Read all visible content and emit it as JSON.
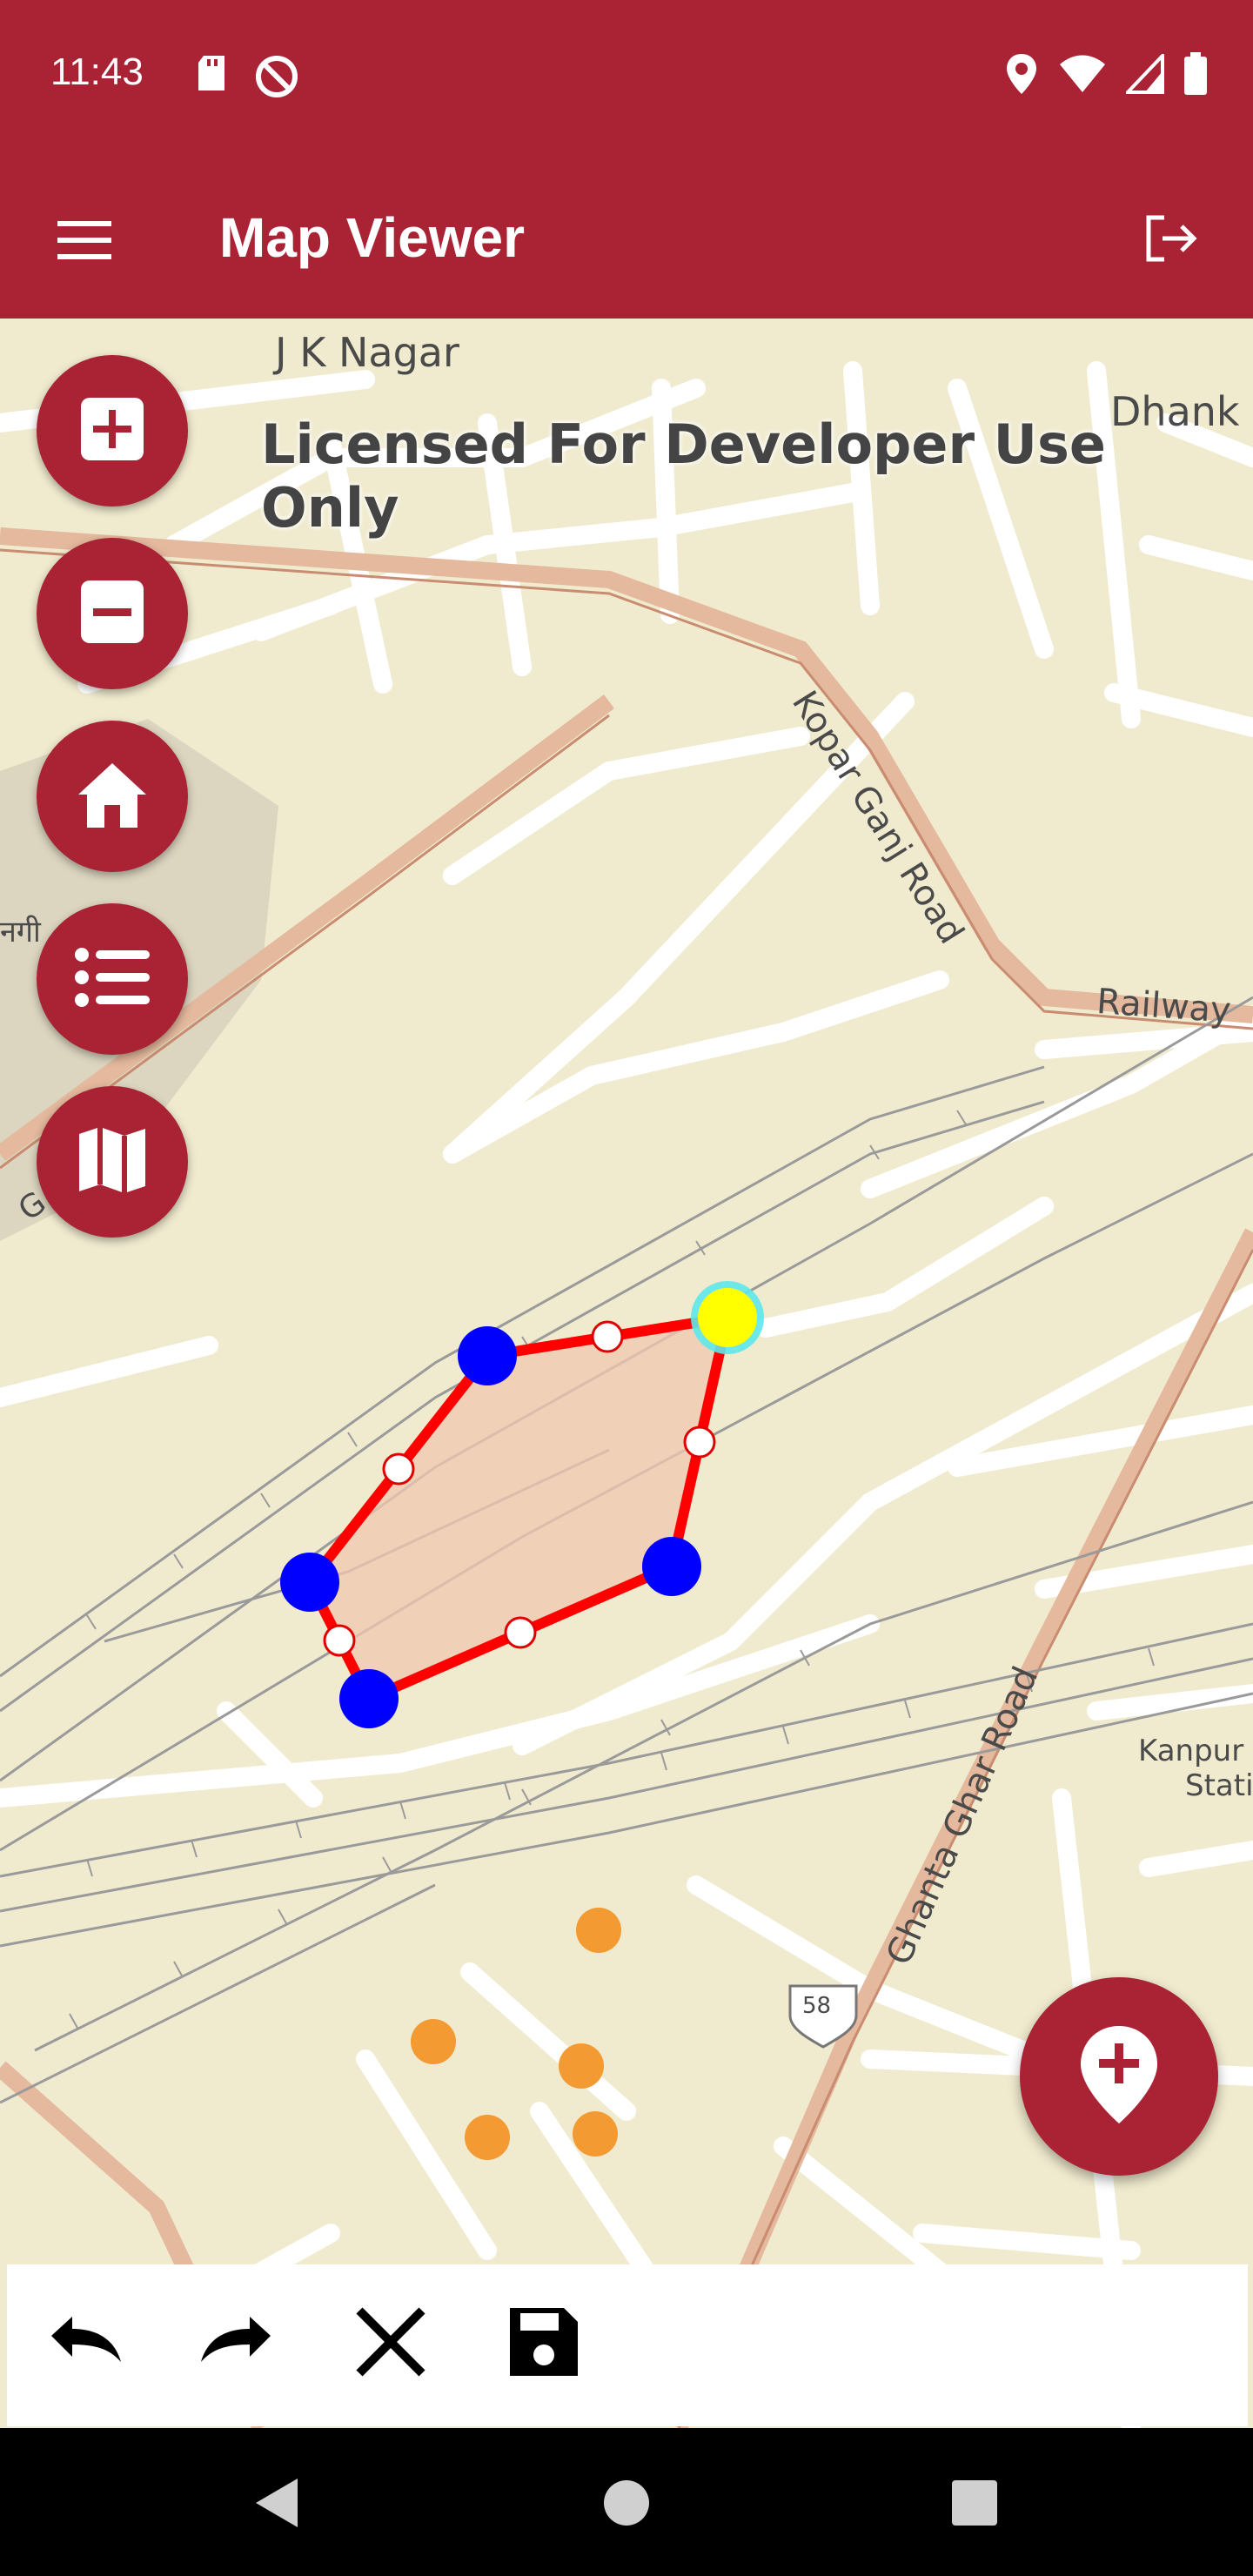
{
  "status_bar": {
    "time": "11:43",
    "icons_left": [
      "sd-card-icon",
      "do-not-disturb-icon"
    ],
    "icons_right": [
      "location-icon",
      "wifi-icon",
      "cell-signal-icon",
      "battery-icon"
    ]
  },
  "app_bar": {
    "title": "Map Viewer",
    "menu_icon": "hamburger-menu-icon",
    "logout_icon": "logout-icon"
  },
  "map": {
    "watermark": "Licensed For Developer Use Only",
    "labels": {
      "jk_nagar": "J K Nagar",
      "dhank": "Dhank",
      "kopar_ganj_road": "Kopar Ganj Road",
      "railway": "Railway",
      "ghanta_ghar_road": "Ghanta Ghar Road",
      "kanpur_station_1": "Kanpur",
      "kanpur_station_2": "Stati",
      "route_58": "58",
      "left_road": "G     Road",
      "left_hindi": "नगी"
    },
    "left_buttons": [
      {
        "name": "zoom-in",
        "icon": "plus-square-icon"
      },
      {
        "name": "zoom-out",
        "icon": "minus-square-icon"
      },
      {
        "name": "home",
        "icon": "home-icon"
      },
      {
        "name": "layers-list",
        "icon": "list-icon"
      },
      {
        "name": "basemap",
        "icon": "map-icon"
      }
    ],
    "add_point_icon": "add-location-icon"
  },
  "edit_toolbar": {
    "buttons": [
      {
        "name": "undo",
        "icon": "undo-icon"
      },
      {
        "name": "redo",
        "icon": "redo-icon"
      },
      {
        "name": "discard",
        "icon": "close-icon"
      },
      {
        "name": "save",
        "icon": "save-icon"
      }
    ]
  },
  "nav_bar": {
    "buttons": [
      "back-icon",
      "home-circle-icon",
      "recents-icon"
    ]
  },
  "colors": {
    "brand": "#a92335",
    "map_background": "#f0ebcf",
    "polygon_stroke": "#ff0000",
    "polygon_fill": "#f2c7b0",
    "vertex": "#0000ff",
    "selected_vertex": "#ffff00",
    "point_feature": "#f39a32"
  }
}
